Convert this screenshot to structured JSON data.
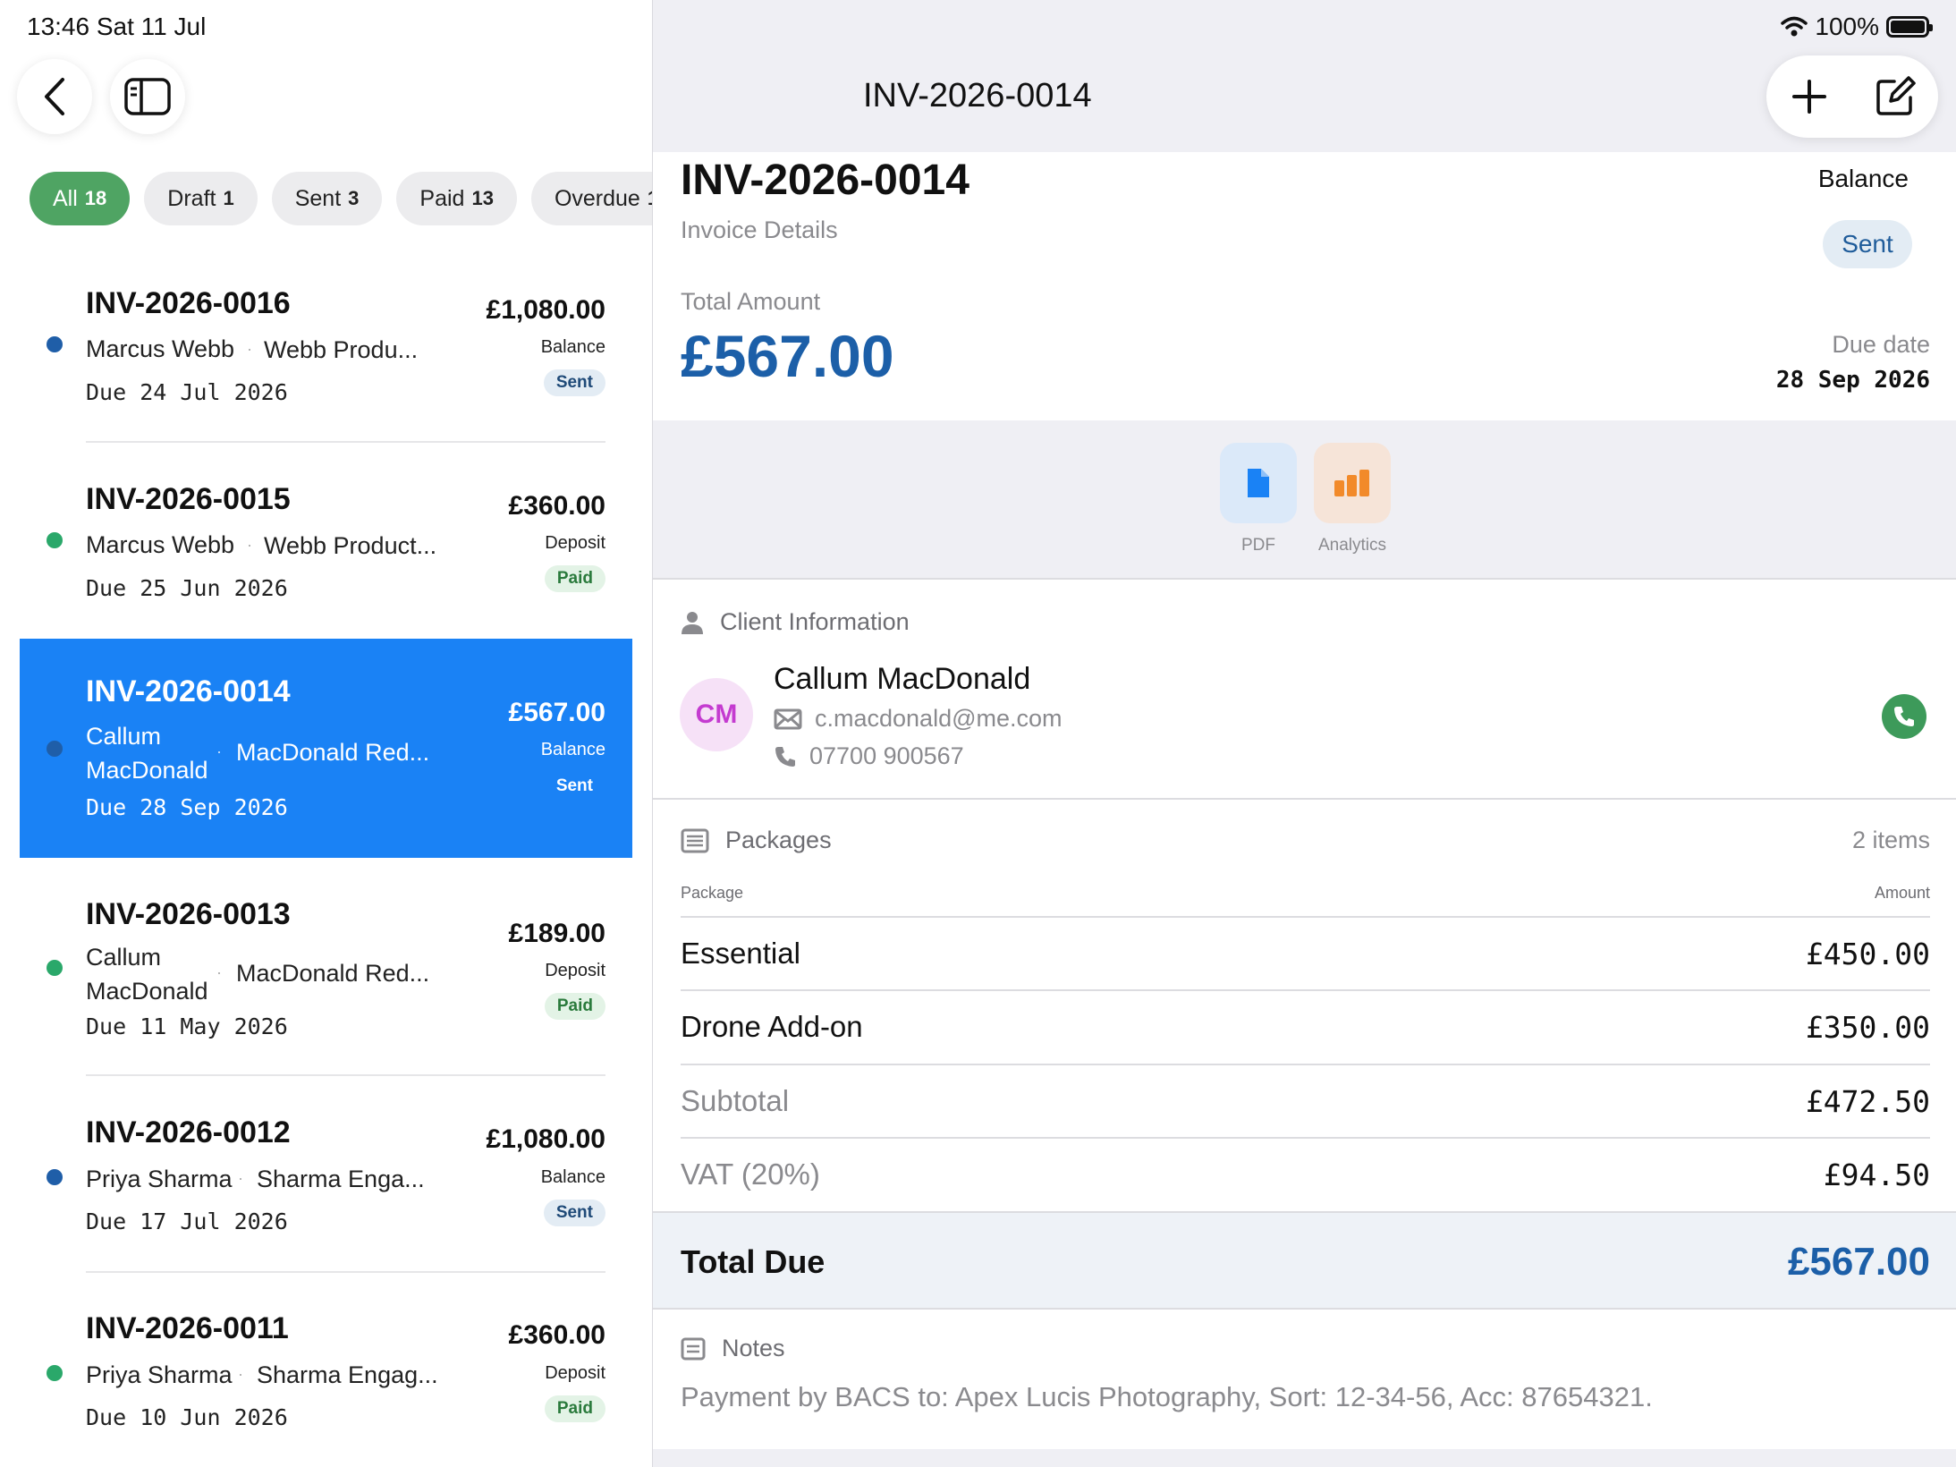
{
  "status": {
    "time": "13:46  Sat 11 Jul",
    "battery": "100%"
  },
  "filters": [
    {
      "label": "All",
      "count": "18"
    },
    {
      "label": "Draft",
      "count": "1"
    },
    {
      "label": "Sent",
      "count": "3"
    },
    {
      "label": "Paid",
      "count": "13"
    },
    {
      "label": "Overdue",
      "count": "1"
    }
  ],
  "invoices": [
    {
      "id": "INV-2026-0016",
      "client": "Marcus Webb",
      "company": "Webb Produ...",
      "due": "Due 24 Jul 2026",
      "amount": "£1,080.00",
      "type": "Balance",
      "status": "Sent",
      "dot_color": "#1f5ea8"
    },
    {
      "id": "INV-2026-0015",
      "client": "Marcus Webb",
      "company": "Webb Product...",
      "due": "Due 25 Jun 2026",
      "amount": "£360.00",
      "type": "Deposit",
      "status": "Paid",
      "dot_color": "#2aa86a"
    },
    {
      "id": "INV-2026-0014",
      "client_line1": "Callum",
      "client_line2": "MacDonald",
      "company": "MacDonald Red...",
      "due": "Due 28 Sep 2026",
      "amount": "£567.00",
      "type": "Balance",
      "status": "Sent",
      "dot_color": "#1f5ea8"
    },
    {
      "id": "INV-2026-0013",
      "client_line1": "Callum",
      "client_line2": "MacDonald",
      "company": "MacDonald Red...",
      "due": "Due 11 May 2026",
      "amount": "£189.00",
      "type": "Deposit",
      "status": "Paid",
      "dot_color": "#2aa86a"
    },
    {
      "id": "INV-2026-0012",
      "client": "Priya Sharma",
      "company": "Sharma Enga...",
      "due": "Due 17 Jul 2026",
      "amount": "£1,080.00",
      "type": "Balance",
      "status": "Sent",
      "dot_color": "#1f5ea8"
    },
    {
      "id": "INV-2026-0011",
      "client": "Priya Sharma",
      "company": "Sharma Engag...",
      "due": "Due 10 Jun 2026",
      "amount": "£360.00",
      "type": "Deposit",
      "status": "Paid",
      "dot_color": "#2aa86a"
    }
  ],
  "detail": {
    "nav_title": "INV-2026-0014",
    "title": "INV-2026-0014",
    "subtitle": "Invoice Details",
    "balance_label": "Balance",
    "status": "Sent",
    "total_label": "Total Amount",
    "total_value": "£567.00",
    "due_label": "Due date",
    "due_value": "28 Sep 2026",
    "actions": [
      {
        "label": "PDF",
        "icon": "document-icon"
      },
      {
        "label": "Analytics",
        "icon": "bar-chart-icon"
      }
    ],
    "client_section": "Client Information",
    "client_initials": "CM",
    "client_name": "Callum MacDonald",
    "client_email": "c.macdonald@me.com",
    "client_phone": "07700 900567",
    "packages_section": "Packages",
    "items_count": "2 items",
    "col_package": "Package",
    "col_amount": "Amount",
    "packages": [
      {
        "name": "Essential",
        "amount": "£450.00"
      },
      {
        "name": "Drone Add-on",
        "amount": "£350.00"
      }
    ],
    "subtotal_label": "Subtotal",
    "subtotal_value": "£472.50",
    "vat_label": "VAT (20%)",
    "vat_value": "£94.50",
    "total_due_label": "Total Due",
    "total_due_value": "£567.00",
    "notes_section": "Notes",
    "notes_text": "Payment by BACS to: Apex Lucis Photography, Sort: 12-34-56, Acc: 87654321."
  },
  "colors": {
    "accent": "#1a82f5",
    "primary_blue": "#1c5fa8",
    "green": "#4fa463"
  }
}
